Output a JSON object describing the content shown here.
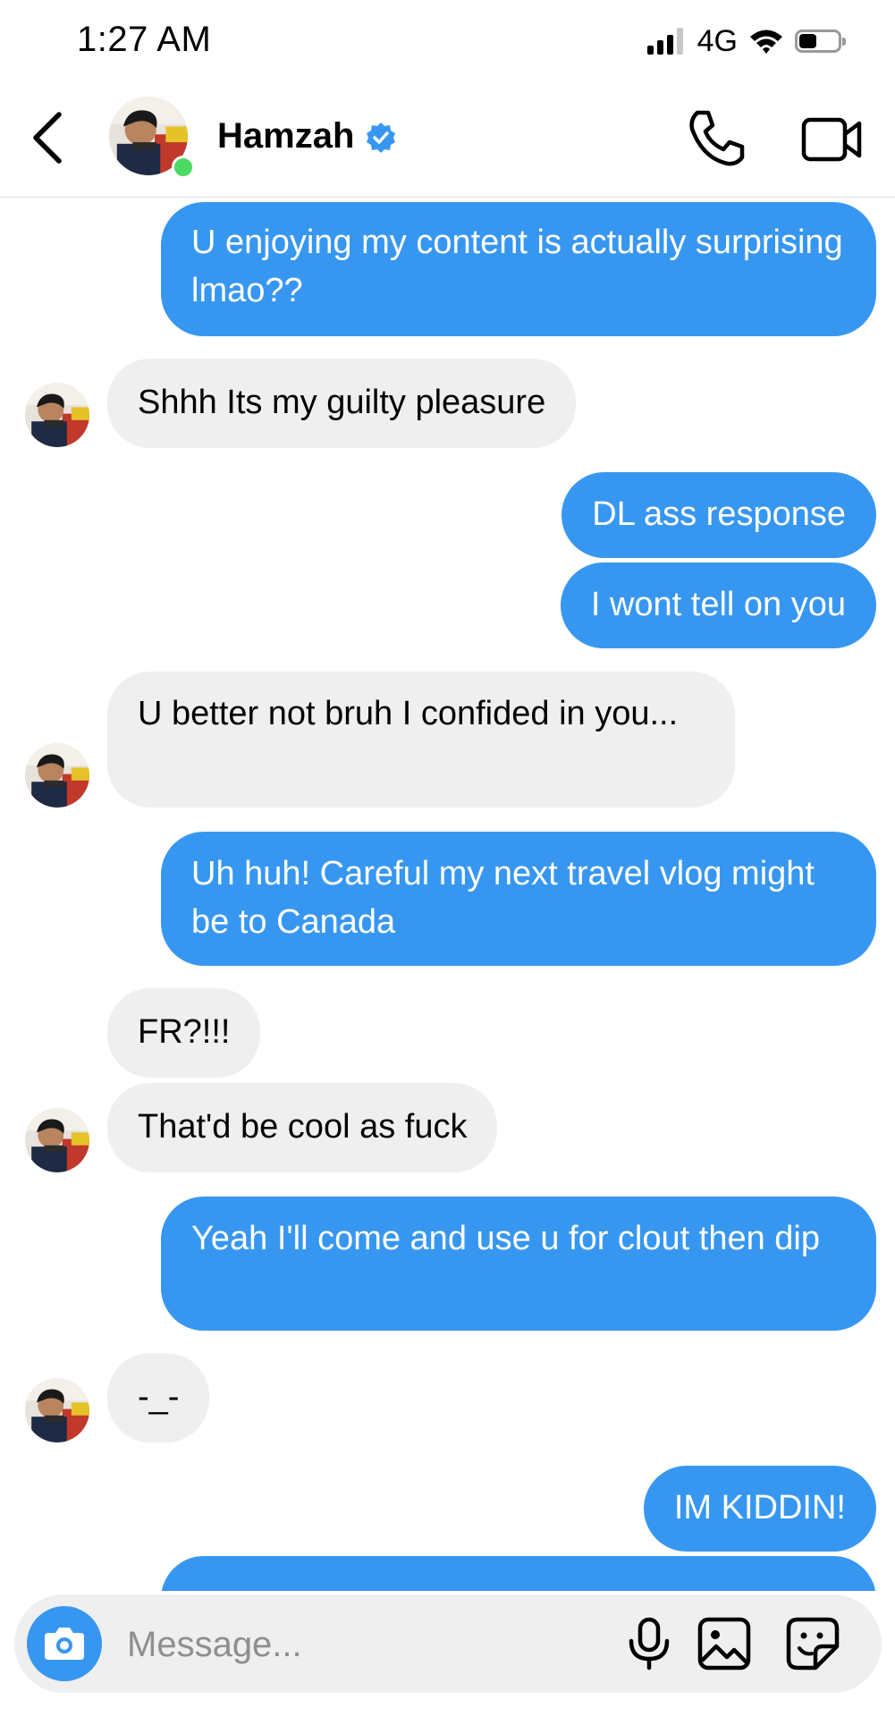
{
  "status_bar": {
    "time": "1:27 AM",
    "network": "4G",
    "signal_bars_active": 3,
    "signal_bars_total": 4,
    "battery_level": 0.45
  },
  "header": {
    "contact_name": "Hamzah",
    "verified": true,
    "online": true,
    "icons": [
      "back-icon",
      "phone-icon",
      "video-camera-icon",
      "verified-badge-icon"
    ]
  },
  "thread": {
    "messages": [
      {
        "from": "me",
        "text": "U enjoying my content is actually surprising lmao??"
      },
      {
        "from": "them",
        "text": "Shhh Its my guilty pleasure"
      },
      {
        "from": "me",
        "text": "DL ass response"
      },
      {
        "from": "me",
        "text": "I wont tell on you"
      },
      {
        "from": "them",
        "text": "U better not bruh I confided in you..."
      },
      {
        "from": "me",
        "text": "Uh huh! Careful my next travel vlog might be to Canada"
      },
      {
        "from": "them",
        "text": "FR?!!!"
      },
      {
        "from": "them",
        "text": "That'd be cool as fuck"
      },
      {
        "from": "me",
        "text": "Yeah I'll come and use u for clout then dip"
      },
      {
        "from": "them",
        "text": "-_-"
      },
      {
        "from": "me",
        "text": "IM KIDDIN!"
      }
    ]
  },
  "composer": {
    "placeholder": "Message...",
    "icons": [
      "camera-icon",
      "microphone-icon",
      "gallery-icon",
      "sticker-icon"
    ]
  },
  "colors": {
    "outgoing_bubble": "#3797f0",
    "incoming_bubble": "#efefef",
    "online_dot": "#4cd964",
    "verified_badge": "#3797f0"
  }
}
